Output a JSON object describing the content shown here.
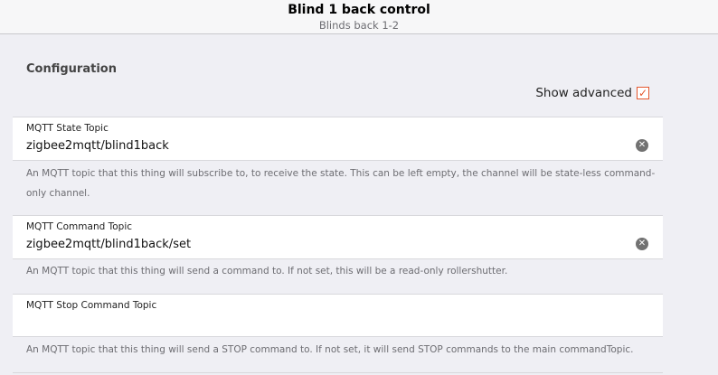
{
  "header": {
    "title": "Blind 1 back control",
    "subtitle": "Blinds back 1-2"
  },
  "section": {
    "title": "Configuration",
    "show_advanced_label": "Show advanced",
    "show_advanced_checked": true
  },
  "fields": [
    {
      "label": "MQTT State Topic",
      "value": "zigbee2mqtt/blind1back",
      "info": "An MQTT topic that this thing will subscribe to, to receive the state. This can be left empty, the channel will be state-less command-only channel."
    },
    {
      "label": "MQTT Command Topic",
      "value": "zigbee2mqtt/blind1back/set",
      "info": "An MQTT topic that this thing will send a command to. If not set, this will be a read-only rollershutter."
    },
    {
      "label": "MQTT Stop Command Topic",
      "value": "",
      "info": "An MQTT topic that this thing will send a STOP command to. If not set, it will send STOP commands to the main commandTopic."
    }
  ],
  "icons": {
    "clear": "clear-circle-icon",
    "check": "checkmark-icon"
  },
  "colors": {
    "accent": "#e4572e",
    "background": "#efeff4"
  }
}
